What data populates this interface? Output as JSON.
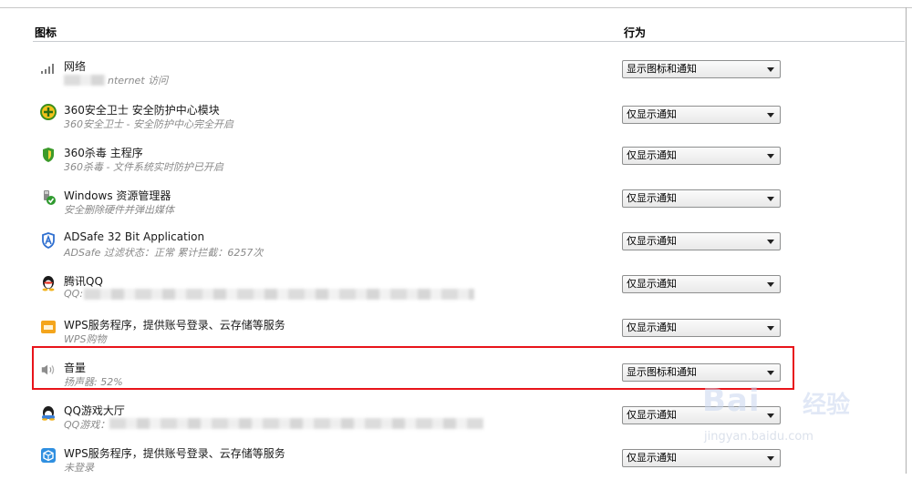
{
  "header": {
    "icon_col": "图标",
    "behavior_col": "行为"
  },
  "rows": [
    {
      "icon": "network-signal-icon",
      "name": "网络",
      "desc": "nternet 访问",
      "behavior": "显示图标和通知"
    },
    {
      "icon": "360-security-icon",
      "name": "360安全卫士 安全防护中心模块",
      "desc": "360安全卫士 - 安全防护中心完全开启",
      "behavior": "仅显示通知"
    },
    {
      "icon": "360-antivirus-shield-icon",
      "name": "360杀毒 主程序",
      "desc": "360杀毒 - 文件系统实时防护已开启",
      "behavior": "仅显示通知"
    },
    {
      "icon": "usb-eject-icon",
      "name": "Windows 资源管理器",
      "desc": "安全删除硬件并弹出媒体",
      "behavior": "仅显示通知"
    },
    {
      "icon": "adsafe-shield-icon",
      "name": "ADSafe 32 Bit Application",
      "desc": "ADSafe 过滤状态：正常 累计拦截：6257次",
      "behavior": "仅显示通知"
    },
    {
      "icon": "qq-penguin-icon",
      "name": "腾讯QQ",
      "desc": "QQ:",
      "behavior": "仅显示通知"
    },
    {
      "icon": "wps-icon",
      "name": "WPS服务程序，提供账号登录、云存储等服务",
      "desc": "WPS购物",
      "behavior": "仅显示通知"
    },
    {
      "icon": "speaker-volume-icon",
      "name": "音量",
      "desc": "扬声器: 52%",
      "behavior": "显示图标和通知"
    },
    {
      "icon": "qq-game-icon",
      "name": "QQ游戏大厅",
      "desc": "QQ游戏：",
      "behavior": "仅显示通知"
    },
    {
      "icon": "wps-cube-icon",
      "name": "WPS服务程序，提供账号登录、云存储等服务",
      "desc": "未登录",
      "behavior": "仅显示通知"
    }
  ],
  "watermark": {
    "main": "Bai",
    "brand_cn": "经验",
    "url": "jingyan.baidu.com"
  }
}
